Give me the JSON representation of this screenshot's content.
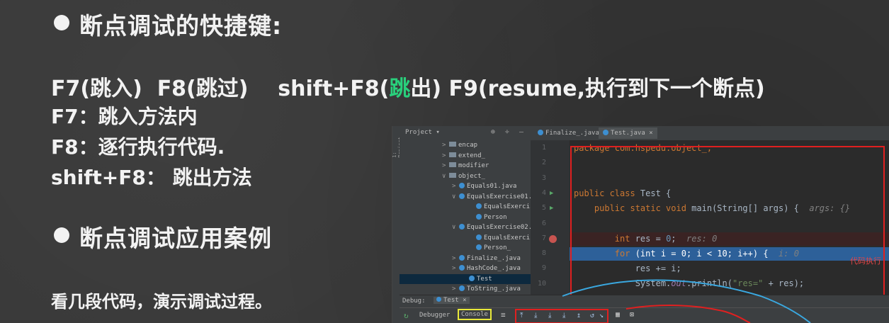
{
  "slide": {
    "heading1": "断点调试的快捷键:",
    "shortcuts": {
      "f7": "F7(跳入)",
      "f8": "F8(跳过)",
      "shift_f8_pre": "shift+F8(",
      "shift_f8_hl": "跳",
      "shift_f8_post": "出)",
      "f9": "F9(resume,执行到下一个断点)"
    },
    "desc": {
      "f7": "F7：跳入方法内",
      "f8": "F8：逐行执行代码.",
      "shift_f8": "shift+F8：  跳出方法"
    },
    "heading2": "断点调试应用案例",
    "footer": "看几段代码，演示调试过程。"
  },
  "ide": {
    "sidebar_label": "1: Project",
    "project_label": "Project ▾",
    "project_tools": "⊕ ÷ —",
    "tree": [
      {
        "label": "encap",
        "type": "folder",
        "arrow": ">",
        "indent": 60
      },
      {
        "label": "extend_",
        "type": "folder",
        "arrow": ">",
        "indent": 60
      },
      {
        "label": "modifier",
        "type": "folder",
        "arrow": ">",
        "indent": 60
      },
      {
        "label": "object_",
        "type": "folder",
        "arrow": "∨",
        "indent": 60
      },
      {
        "label": "Equals01.java",
        "type": "class",
        "arrow": ">",
        "indent": 74
      },
      {
        "label": "EqualsExercise01.java",
        "type": "class",
        "arrow": "∨",
        "indent": 74
      },
      {
        "label": "EqualsExercise01",
        "type": "class",
        "arrow": "",
        "indent": 98
      },
      {
        "label": "Person",
        "type": "class",
        "arrow": "",
        "indent": 98
      },
      {
        "label": "EqualsExercise02.java",
        "type": "class",
        "arrow": "∨",
        "indent": 74
      },
      {
        "label": "EqualsExercise02",
        "type": "class",
        "arrow": "",
        "indent": 98
      },
      {
        "label": "Person_",
        "type": "class",
        "arrow": "",
        "indent": 98
      },
      {
        "label": "Finalize_.java",
        "type": "class",
        "arrow": ">",
        "indent": 74
      },
      {
        "label": "HashCode_.java",
        "type": "class",
        "arrow": ">",
        "indent": 74
      },
      {
        "label": "Test",
        "type": "class",
        "arrow": "",
        "indent": 88,
        "selected": true
      },
      {
        "label": "ToString_.java",
        "type": "class",
        "arrow": ">",
        "indent": 74
      }
    ],
    "tabs": [
      {
        "label": "Finalize_.java",
        "active": false
      },
      {
        "label": "Test.java",
        "active": true
      }
    ],
    "line_numbers": [
      "1",
      "2",
      "3",
      "4",
      "5",
      "6",
      "7",
      "8",
      "9",
      "10"
    ],
    "code": {
      "l1": "package com.hspedu.object_;",
      "l3_kw": "public class",
      "l3_rest": " Test {",
      "l4_kw": "    public static void",
      "l4_rest": " main(String[] args) {",
      "l4_hint": "args: {}",
      "l6_kw": "        int",
      "l6_rest": " res = ",
      "l6_num": "0",
      "l6_semi": ";",
      "l6_hint": "res: 0",
      "l7_kw": "        for",
      "l7_rest": " (int i = 0; i < 10; i++) {",
      "l7_hint": "i: 0",
      "l8": "            res += i;",
      "l9_pre": "            System.",
      "l9_out": "out",
      "l9_mid": ".println(",
      "l9_str": "\"res=\"",
      "l9_post": " + res);",
      "l10": "        }"
    },
    "red_note": "代码执行",
    "debug_label": "Debug:",
    "debug_tab": "Test",
    "debugger_tab": "Debugger",
    "console_tab": "Console",
    "colors": {
      "accent": "#2d6099",
      "annot": "#e02020",
      "console_box": "#e8e83a",
      "curve": "#3aa8e0"
    }
  }
}
